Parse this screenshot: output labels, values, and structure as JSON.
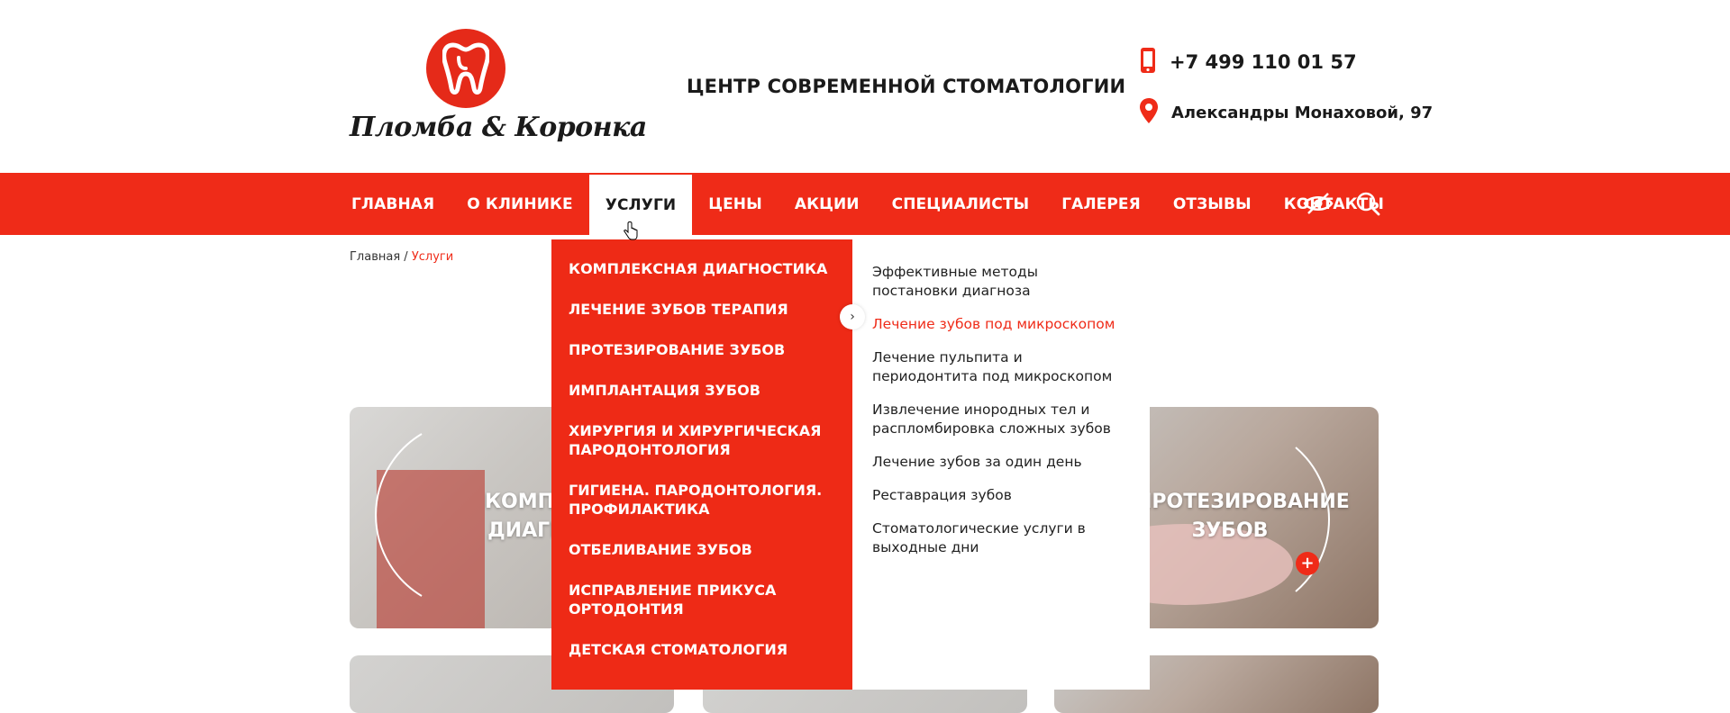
{
  "brand": {
    "name": "Пломба & Коронка",
    "tagline": "ЦЕНТР СОВРЕМЕННОЙ СТОМАТОЛОГИИ",
    "accent": "#ef2b18"
  },
  "contacts": {
    "phone": "+7 499 110 01 57",
    "address": "Александры Монаховой, 97",
    "phone_icon": "phone-icon",
    "address_icon": "map-pin-icon"
  },
  "nav": {
    "items": [
      {
        "label": "ГЛАВНАЯ"
      },
      {
        "label": "О КЛИНИКЕ"
      },
      {
        "label": "УСЛУГИ"
      },
      {
        "label": "ЦЕНЫ"
      },
      {
        "label": "АКЦИИ"
      },
      {
        "label": "СПЕЦИАЛИСТЫ"
      },
      {
        "label": "ГАЛЕРЕЯ"
      },
      {
        "label": "ОТЗЫВЫ"
      },
      {
        "label": "КОНТАКТЫ"
      }
    ],
    "active": "УСЛУГИ",
    "icons": [
      "low-vision-icon",
      "search-icon"
    ]
  },
  "breadcrumb": {
    "home": "Главная",
    "separator": " / ",
    "current": "Услуги"
  },
  "cards": {
    "first_title_line1": "КОМПЛЕКСНА",
    "first_title_line2": "ДИАГНОСТИК",
    "third_title_line1": "ПРОТЕЗИРОВАНИЕ",
    "third_title_line2": "ЗУБОВ",
    "plus": "+"
  },
  "dropdown": {
    "categories": [
      {
        "label": "КОМПЛЕКСНАЯ ДИАГНОСТИКА"
      },
      {
        "label": "ЛЕЧЕНИЕ ЗУБОВ ТЕРАПИЯ"
      },
      {
        "label": "ПРОТЕЗИРОВАНИЕ ЗУБОВ"
      },
      {
        "label": "ИМПЛАНТАЦИЯ ЗУБОВ"
      },
      {
        "label": "ХИРУРГИЯ И ХИРУРГИЧЕСКАЯ ПАРОДОНТОЛОГИЯ"
      },
      {
        "label": "ГИГИЕНА. ПАРОДОНТОЛОГИЯ. ПРОФИЛАКТИКА"
      },
      {
        "label": "ОТБЕЛИВАНИЕ ЗУБОВ"
      },
      {
        "label": "ИСПРАВЛЕНИЕ ПРИКУСА ОРТОДОНТИЯ"
      },
      {
        "label": "ДЕТСКАЯ СТОМАТОЛОГИЯ"
      }
    ],
    "subitems": [
      {
        "label": "Эффективные методы постановки диагноза"
      },
      {
        "label": "Лечение зубов под микроскопом"
      },
      {
        "label": "Лечение пульпита и периодонтита под микроскопом"
      },
      {
        "label": "Извлечение инородных тел и распломбировка сложных зубов"
      },
      {
        "label": "Лечение зубов за один день"
      },
      {
        "label": "Реставрация зубов"
      },
      {
        "label": "Стоматологические услуги в выходные дни"
      }
    ],
    "arrow": "›"
  }
}
